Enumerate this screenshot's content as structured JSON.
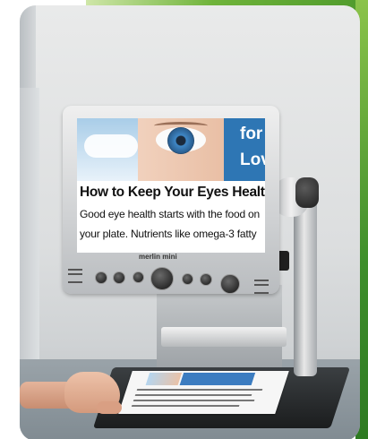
{
  "scene": {
    "description_type": "product-photo",
    "accent_color": "#4f9a2c",
    "screen_panel_color": "#2e76b4"
  },
  "screen": {
    "panel_line_1": "for",
    "panel_line_2": "Lov",
    "headline": "How to Keep Your Eyes Health",
    "body_line_1": "Good eye health starts with the food on",
    "body_line_2": "your plate. Nutrients like omega-3 fatty"
  },
  "device": {
    "brand_label": "merlin mini"
  }
}
